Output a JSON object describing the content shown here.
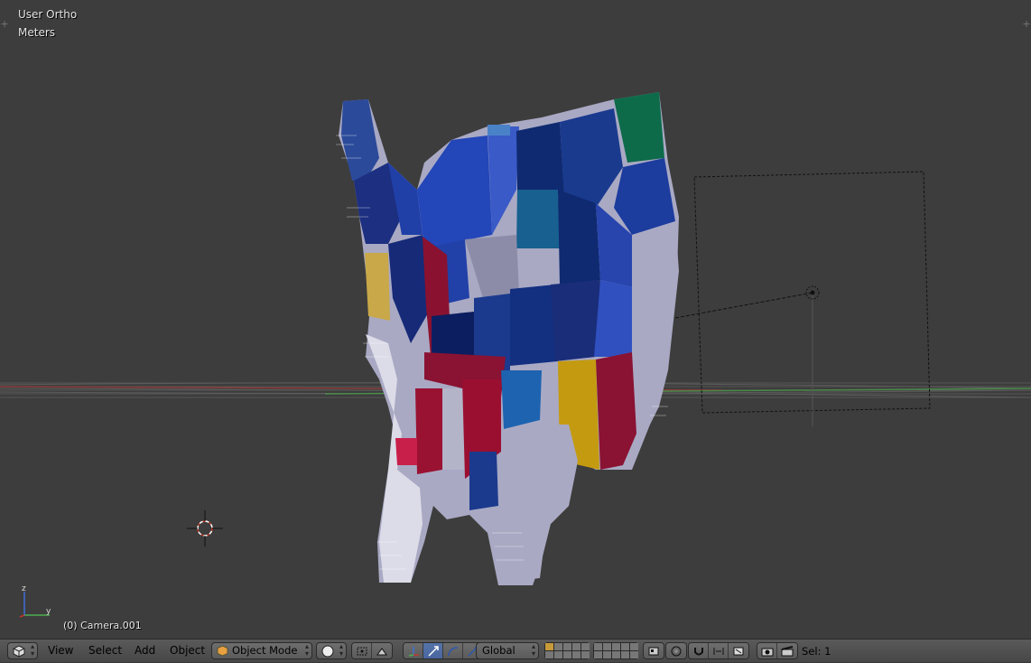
{
  "viewport": {
    "view_name": "User Ortho",
    "units": "Meters",
    "active_object": "(0) Camera.001",
    "axes": {
      "z": "z",
      "y": "y"
    },
    "corner_widget": "+"
  },
  "header": {
    "editor_type_icon": "cube-icon",
    "menus": {
      "view": "View",
      "select": "Select",
      "add": "Add",
      "object": "Object"
    },
    "mode": "Object Mode",
    "viewport_shading_icon": "sphere-icon",
    "pivot_icon": "bounding-box-icon",
    "manipulator_active": "translate",
    "orientation": "Global",
    "selection_info": "Sel: 1"
  },
  "colors": {
    "viewport_bg": "#3d3d3d",
    "header_bg": "#505050",
    "selected_button": "#5573a8",
    "x_axis": "#c0392b",
    "y_axis": "#4caf50",
    "z_axis": "#3f6fd8"
  }
}
